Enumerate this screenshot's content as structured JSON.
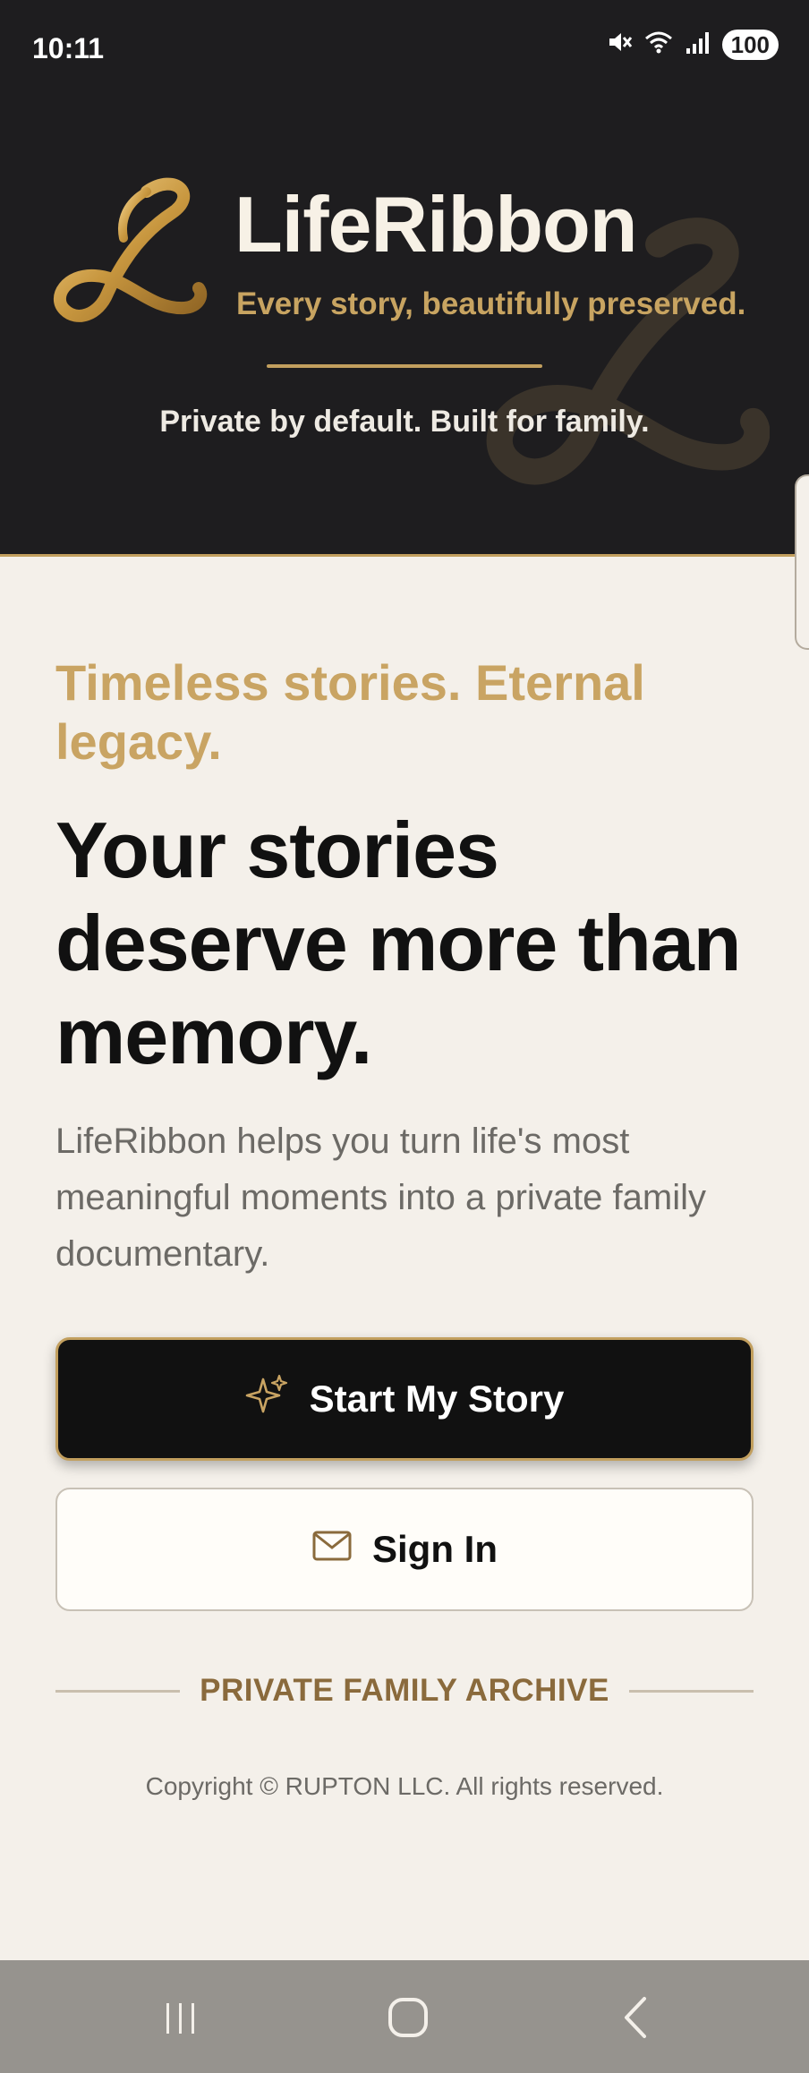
{
  "status_bar": {
    "time": "10:11",
    "battery": "100",
    "icons": [
      "mute-icon",
      "wifi-icon",
      "signal-icon",
      "battery-icon"
    ]
  },
  "header": {
    "app_title": "LifeRibbon",
    "tagline": "Every story, beautifully preserved.",
    "private_note": "Private by default. Built for family.",
    "logo_icon": "ribbon-l-logo-icon"
  },
  "hero": {
    "eyebrow": "Timeless stories. Eternal legacy.",
    "headline": "Your stories deserve more than memory.",
    "description": "LifeRibbon helps you turn life's most meaningful moments into a private family documentary."
  },
  "actions": {
    "start_label": "Start My Story",
    "start_icon": "sparkle-icon",
    "signin_label": "Sign In",
    "signin_icon": "mail-icon"
  },
  "footer": {
    "archive_label": "PRIVATE FAMILY ARCHIVE",
    "copyright": "Copyright © RUPTON LLC. All rights reserved."
  },
  "nav_bar": {
    "buttons": [
      "recent-apps-icon",
      "home-icon",
      "back-icon"
    ]
  },
  "colors": {
    "header_bg": "#1e1d1f",
    "gold": "#c29f5e",
    "page_bg": "#f4f0ea",
    "primary_button": "#111111"
  }
}
